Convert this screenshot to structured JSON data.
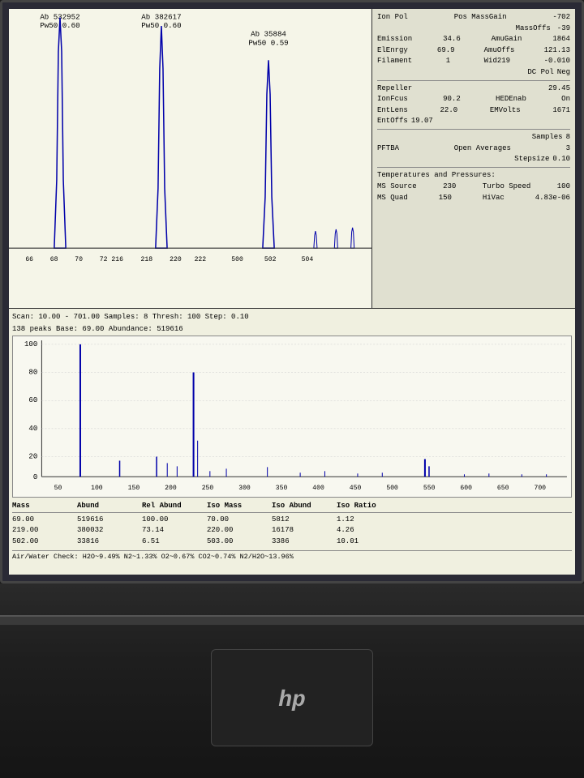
{
  "screen": {
    "top_spectra": {
      "peaks": [
        {
          "label_line1": "Ab  532952",
          "label_line2": "Pw50   0.60",
          "x_pct": 15,
          "height_pct": 92,
          "x_axis_label": "66"
        },
        {
          "label_line1": "Ab  382617",
          "label_line2": "Pw50   0.60",
          "x_pct": 42,
          "height_pct": 90,
          "x_axis_label": "72 216"
        },
        {
          "label_line1": "Ab   35884",
          "label_line2": "Pw50   0.59",
          "x_pct": 70,
          "height_pct": 72,
          "x_axis_label": "220"
        }
      ],
      "x_axis": [
        "66",
        "68",
        "70",
        "72 216",
        "218",
        "220",
        "222",
        "500",
        "502",
        "504"
      ]
    },
    "params": {
      "ion_pol": "Ion Pol",
      "pos_mass_gain": "Pos MassGain",
      "value_702": "-702",
      "mass_offs": "MassOffs",
      "mass_offs_val": "-39",
      "emission": "Emission",
      "emission_val": "34.6",
      "amu_gain": "AmuGain",
      "amu_gain_val": "1864",
      "el_enrgy": "ElEnrgy",
      "el_enrgy_val": "69.9",
      "amu_offs": "AmuOffs",
      "amu_offs_val": "121.13",
      "filament": "Filament",
      "filament_val": "1",
      "wid219": "Wid219",
      "wid219_val": "-0.010",
      "dc_pol": "DC Pol",
      "dc_pol_val": "Neg",
      "repeller": "Repeller",
      "repeller_val": "29.45",
      "ion_focs": "IonFcus",
      "ion_focs_val": "90.2",
      "hed_enab": "HEDEnab",
      "hed_enab_val": "On",
      "ent_lens": "EntLens",
      "ent_lens_val": "22.0",
      "em_volts": "EMVolts",
      "em_volts_val": "1671",
      "ent_offs": "EntOffs",
      "ent_offs_val": "19.07",
      "samples": "Samples",
      "samples_val": "8",
      "pftba": "PFTBA",
      "open_averages": "Open Averages",
      "open_averages_val": "3",
      "stepsize": "Stepsize",
      "stepsize_val": "0.10",
      "temp_pressure_title": "Temperatures and Pressures:",
      "ms_source": "MS Source",
      "ms_source_val": "230",
      "turbo_speed": "Turbo Speed",
      "turbo_speed_val": "100",
      "ms_quad": "MS Quad",
      "ms_quad_val": "150",
      "hivac": "HiVac",
      "hivac_val": "4.83e-06"
    },
    "bottom": {
      "scan_info_1": "Scan: 10.00 - 701.00 Samples: 8 Thresh: 100 Step: 0.10",
      "scan_info_2": "138 peaks  Base: 69.00  Abundance: 519616",
      "y_axis": [
        "100",
        "80",
        "60",
        "40",
        "20",
        "0"
      ],
      "x_axis": [
        "50",
        "100",
        "150",
        "200",
        "250",
        "300",
        "350",
        "400",
        "450",
        "500",
        "550",
        "600",
        "650",
        "700"
      ],
      "table": {
        "headers": [
          "Mass",
          "Abund",
          "Rel Abund",
          "Iso Mass",
          "Iso Abund",
          "Iso Ratio"
        ],
        "rows": [
          [
            "69.00",
            "519616",
            "100.00",
            "70.00",
            "5812",
            "1.12"
          ],
          [
            "219.00",
            "380032",
            "73.14",
            "220.00",
            "16178",
            "4.26"
          ],
          [
            "502.00",
            "33816",
            "6.51",
            "503.00",
            "3386",
            "10.01"
          ]
        ]
      },
      "air_water": "Air/Water Check: H2O~9.49%  N2~1.33%  O2~0.67%  CO2~0.74%  N2/H2O~13.96%"
    }
  },
  "laptop": {
    "logo": "hp"
  }
}
